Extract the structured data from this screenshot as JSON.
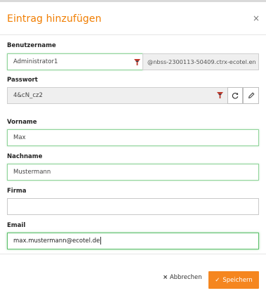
{
  "dialog": {
    "title": "Eintrag hinzufügen",
    "close_symbol": "×"
  },
  "username": {
    "label": "Benutzername",
    "value": "Administrator1",
    "suffix": "@nbss-2300113-50409.ctrx-ecotel.en"
  },
  "password": {
    "label": "Passwort",
    "value": "4&cN_cz2",
    "refresh_icon": "refresh-icon",
    "edit_icon": "pencil-icon"
  },
  "firstname": {
    "label": "Vorname",
    "value": "Max"
  },
  "lastname": {
    "label": "Nachname",
    "value": "Mustermann"
  },
  "company": {
    "label": "Firma",
    "value": ""
  },
  "email": {
    "label": "Email",
    "value": "max.mustermann@ecotel.de"
  },
  "footer": {
    "cancel_label": "Abbrechen",
    "cancel_symbol": "×",
    "save_label": "Speichern",
    "save_symbol": "✓"
  },
  "colors": {
    "accent": "#f07d00",
    "save_button": "#f5861f",
    "valid_border": "#8fd39a"
  }
}
